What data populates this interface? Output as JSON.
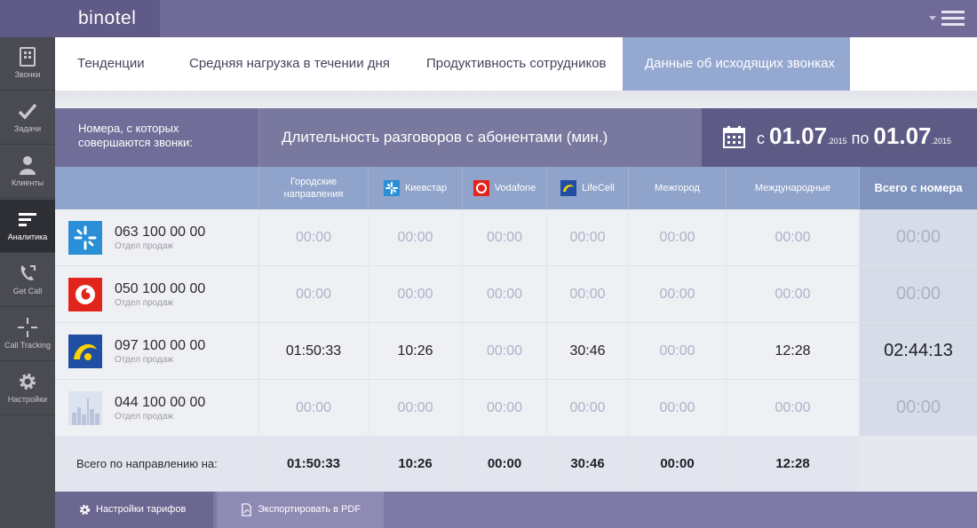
{
  "app": {
    "logo": "binotel"
  },
  "sidebar": {
    "items": [
      {
        "label": "Звонки",
        "icon": "phone-book-icon",
        "active": false
      },
      {
        "label": "Задачи",
        "icon": "checkmark-icon",
        "active": false
      },
      {
        "label": "Клиенты",
        "icon": "person-icon",
        "active": false
      },
      {
        "label": "Аналитика",
        "icon": "bars-icon",
        "active": true
      },
      {
        "label": "Get Call",
        "icon": "phone-handset-icon",
        "active": false
      },
      {
        "label": "Call Tracking",
        "icon": "crosshair-icon",
        "active": false
      },
      {
        "label": "Настройки",
        "icon": "gear-icon",
        "active": false
      }
    ]
  },
  "tabs": [
    {
      "label": "Тенденции",
      "active": false
    },
    {
      "label": "Средняя нагрузка в течении дня",
      "active": false
    },
    {
      "label": "Продуктивность сотрудников",
      "active": false
    },
    {
      "label": "Данные об исходящих звонках",
      "active": true
    }
  ],
  "header": {
    "numbers_label": "Номера, с которых совершаются звонки:",
    "title": "Длительность разговоров с абонентами (мин.)",
    "date": {
      "from_word": "с",
      "from": "01.07",
      "from_year": ".2015",
      "to_word": "по",
      "to": "01.07",
      "to_year": ".2015"
    }
  },
  "columns": {
    "city": "Городские направления",
    "kyivstar": "Киевстар",
    "vodafone": "Vodafone",
    "lifecell": "LifeCell",
    "intercity": "Межгород",
    "international": "Международные",
    "total": "Всего с номера"
  },
  "rows": [
    {
      "operator": "kyivstar",
      "number": "063 100 00 00",
      "dept": "Отдел продаж",
      "values": [
        "00:00",
        "00:00",
        "00:00",
        "00:00",
        "00:00",
        "00:00"
      ],
      "total": "00:00"
    },
    {
      "operator": "vodafone",
      "number": "050 100 00 00",
      "dept": "Отдел продаж",
      "values": [
        "00:00",
        "00:00",
        "00:00",
        "00:00",
        "00:00",
        "00:00"
      ],
      "total": "00:00"
    },
    {
      "operator": "lifecell",
      "number": "097 100 00 00",
      "dept": "Отдел продаж",
      "values": [
        "01:50:33",
        "10:26",
        "00:00",
        "30:46",
        "00:00",
        "12:28"
      ],
      "total": "02:44:13"
    },
    {
      "operator": "city",
      "number": "044 100 00 00",
      "dept": "Отдел продаж",
      "values": [
        "00:00",
        "00:00",
        "00:00",
        "00:00",
        "00:00",
        "00:00"
      ],
      "total": "00:00"
    }
  ],
  "totals": {
    "label": "Всего по направлению на:",
    "values": [
      "01:50:33",
      "10:26",
      "00:00",
      "30:46",
      "00:00",
      "12:28"
    ],
    "total": ""
  },
  "footer": {
    "tariffs_label": "Настройки тарифов",
    "export_label": "Экспортировать в PDF"
  },
  "colors": {
    "accent": "#6f6a97",
    "active_tab": "#94a8d0",
    "sidebar": "#4a4a52",
    "header": "#79789e"
  }
}
